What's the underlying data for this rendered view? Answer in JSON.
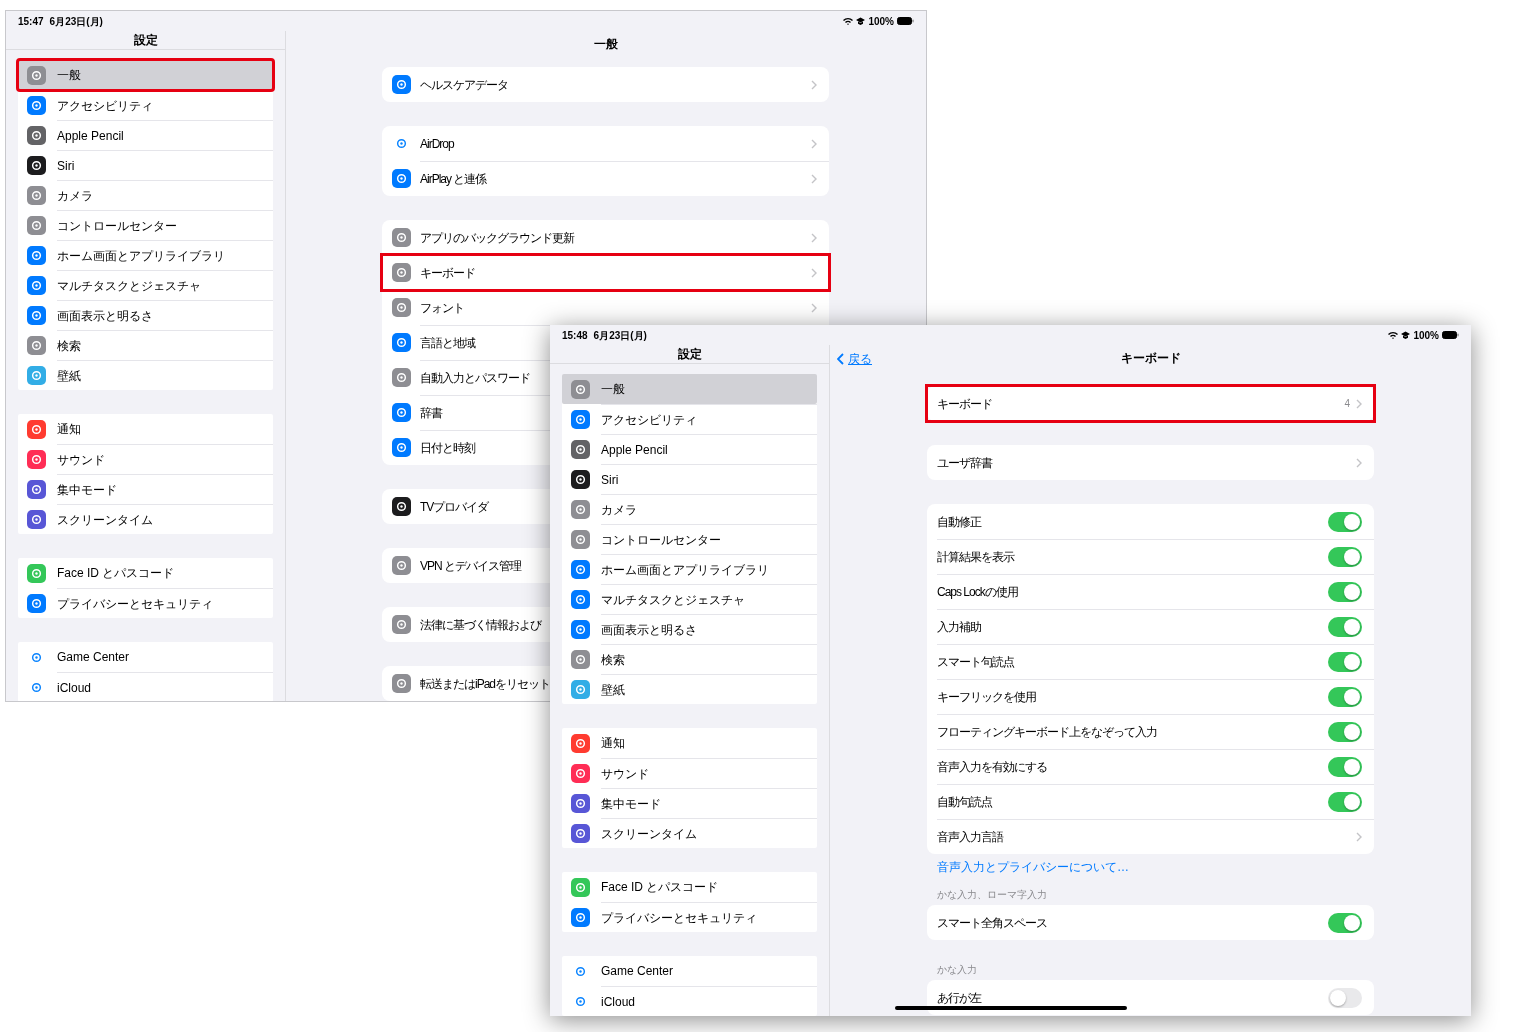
{
  "back_screen": {
    "status_bar": {
      "time": "15:47",
      "date": "6月23日(月)",
      "battery": "100%"
    },
    "sidebar": {
      "title": "設定",
      "groups": [
        {
          "items": [
            {
              "label": "一般",
              "color": "#8e8e93",
              "selected": true,
              "highlighted": true
            },
            {
              "label": "アクセシビリティ",
              "color": "#007aff",
              "selected": false,
              "highlighted": false
            },
            {
              "label": "Apple Pencil",
              "color": "#636366",
              "selected": false,
              "highlighted": false
            },
            {
              "label": "Siri",
              "color": "#1c1c1e",
              "selected": false,
              "highlighted": false
            },
            {
              "label": "カメラ",
              "color": "#8e8e93",
              "selected": false,
              "highlighted": false
            },
            {
              "label": "コントロールセンター",
              "color": "#8e8e93",
              "selected": false,
              "highlighted": false
            },
            {
              "label": "ホーム画面とアプリライブラリ",
              "color": "#007aff",
              "selected": false,
              "highlighted": false
            },
            {
              "label": "マルチタスクとジェスチャ",
              "color": "#007aff",
              "selected": false,
              "highlighted": false
            },
            {
              "label": "画面表示と明るさ",
              "color": "#007aff",
              "selected": false,
              "highlighted": false
            },
            {
              "label": "検索",
              "color": "#8e8e93",
              "selected": false,
              "highlighted": false
            },
            {
              "label": "壁紙",
              "color": "#32ade6",
              "selected": false,
              "highlighted": false
            }
          ]
        },
        {
          "items": [
            {
              "label": "通知",
              "color": "#ff3b30",
              "selected": false,
              "highlighted": false
            },
            {
              "label": "サウンド",
              "color": "#ff2d55",
              "selected": false,
              "highlighted": false
            },
            {
              "label": "集中モード",
              "color": "#5856d6",
              "selected": false,
              "highlighted": false
            },
            {
              "label": "スクリーンタイム",
              "color": "#5856d6",
              "selected": false,
              "highlighted": false
            }
          ]
        },
        {
          "items": [
            {
              "label": "Face ID とパスコード",
              "color": "#34c759",
              "selected": false,
              "highlighted": false
            },
            {
              "label": "プライバシーとセキュリティ",
              "color": "#007aff",
              "selected": false,
              "highlighted": false
            }
          ]
        },
        {
          "items": [
            {
              "label": "Game Center",
              "color": "#ffffff",
              "selected": false,
              "highlighted": false
            },
            {
              "label": "iCloud",
              "color": "#ffffff",
              "selected": false,
              "highlighted": false
            }
          ]
        }
      ]
    },
    "detail": {
      "title": "一般",
      "sections": [
        {
          "rows": [
            {
              "label": "ヘルスケアデータ",
              "color": "#007aff",
              "kind": "link",
              "highlighted": false
            }
          ]
        },
        {
          "rows": [
            {
              "label": "AirDrop",
              "color": "#ffffff",
              "kind": "link",
              "highlighted": false
            },
            {
              "label": "AirPlay と連係",
              "color": "#007aff",
              "kind": "link",
              "highlighted": false
            }
          ]
        },
        {
          "rows": [
            {
              "label": "アプリのバックグラウンド更新",
              "color": "#8e8e93",
              "kind": "link",
              "highlighted": false
            },
            {
              "label": "キーボード",
              "color": "#8e8e93",
              "kind": "link",
              "highlighted": true
            },
            {
              "label": "フォント",
              "color": "#8e8e93",
              "kind": "link",
              "highlighted": false
            },
            {
              "label": "言語と地域",
              "color": "#007aff",
              "kind": "link",
              "highlighted": false
            },
            {
              "label": "自動入力とパスワード",
              "color": "#8e8e93",
              "kind": "link",
              "highlighted": false
            },
            {
              "label": "辞書",
              "color": "#007aff",
              "kind": "link",
              "highlighted": false
            },
            {
              "label": "日付と時刻",
              "color": "#007aff",
              "kind": "link",
              "highlighted": false
            }
          ]
        },
        {
          "rows": [
            {
              "label": "TVプロバイダ",
              "color": "#1c1c1e",
              "kind": "link",
              "highlighted": false
            }
          ]
        },
        {
          "rows": [
            {
              "label": "VPN とデバイス管理",
              "color": "#8e8e93",
              "kind": "link",
              "highlighted": false
            }
          ]
        },
        {
          "rows": [
            {
              "label": "法律に基づく情報および",
              "color": "#8e8e93",
              "kind": "link",
              "highlighted": false
            }
          ]
        },
        {
          "rows": [
            {
              "label": "転送またはiPadをリセット",
              "color": "#8e8e93",
              "kind": "link",
              "highlighted": false
            }
          ]
        }
      ]
    }
  },
  "front_screen": {
    "status_bar": {
      "time": "15:48",
      "date": "6月23日(月)",
      "battery": "100%"
    },
    "sidebar": {
      "title": "設定",
      "groups": [
        {
          "items": [
            {
              "label": "一般",
              "color": "#8e8e93",
              "selected": true,
              "highlighted": false
            },
            {
              "label": "アクセシビリティ",
              "color": "#007aff",
              "selected": false,
              "highlighted": false
            },
            {
              "label": "Apple Pencil",
              "color": "#636366",
              "selected": false,
              "highlighted": false
            },
            {
              "label": "Siri",
              "color": "#1c1c1e",
              "selected": false,
              "highlighted": false
            },
            {
              "label": "カメラ",
              "color": "#8e8e93",
              "selected": false,
              "highlighted": false
            },
            {
              "label": "コントロールセンター",
              "color": "#8e8e93",
              "selected": false,
              "highlighted": false
            },
            {
              "label": "ホーム画面とアプリライブラリ",
              "color": "#007aff",
              "selected": false,
              "highlighted": false
            },
            {
              "label": "マルチタスクとジェスチャ",
              "color": "#007aff",
              "selected": false,
              "highlighted": false
            },
            {
              "label": "画面表示と明るさ",
              "color": "#007aff",
              "selected": false,
              "highlighted": false
            },
            {
              "label": "検索",
              "color": "#8e8e93",
              "selected": false,
              "highlighted": false
            },
            {
              "label": "壁紙",
              "color": "#32ade6",
              "selected": false,
              "highlighted": false
            }
          ]
        },
        {
          "items": [
            {
              "label": "通知",
              "color": "#ff3b30",
              "selected": false,
              "highlighted": false
            },
            {
              "label": "サウンド",
              "color": "#ff2d55",
              "selected": false,
              "highlighted": false
            },
            {
              "label": "集中モード",
              "color": "#5856d6",
              "selected": false,
              "highlighted": false
            },
            {
              "label": "スクリーンタイム",
              "color": "#5856d6",
              "selected": false,
              "highlighted": false
            }
          ]
        },
        {
          "items": [
            {
              "label": "Face ID とパスコード",
              "color": "#34c759",
              "selected": false,
              "highlighted": false
            },
            {
              "label": "プライバシーとセキュリティ",
              "color": "#007aff",
              "selected": false,
              "highlighted": false
            }
          ]
        },
        {
          "items": [
            {
              "label": "Game Center",
              "color": "#ffffff",
              "selected": false,
              "highlighted": false
            },
            {
              "label": "iCloud",
              "color": "#ffffff",
              "selected": false,
              "highlighted": false
            }
          ]
        }
      ]
    },
    "detail": {
      "back_link": "戻る",
      "title": "キーボード",
      "sections": [
        {
          "rows": [
            {
              "label": "キーボード",
              "kind": "link",
              "value": "4",
              "highlighted": true
            }
          ]
        },
        {
          "rows": [
            {
              "label": "ユーザ辞書",
              "kind": "link",
              "highlighted": false
            }
          ]
        },
        {
          "rows": [
            {
              "label": "自動修正",
              "kind": "toggle",
              "on": true,
              "highlighted": false
            },
            {
              "label": "計算結果を表示",
              "kind": "toggle",
              "on": true,
              "highlighted": false
            },
            {
              "label": "Caps Lockの使用",
              "kind": "toggle",
              "on": true,
              "highlighted": false
            },
            {
              "label": "入力補助",
              "kind": "toggle",
              "on": true,
              "highlighted": false
            },
            {
              "label": "スマート句読点",
              "kind": "toggle",
              "on": true,
              "highlighted": false
            },
            {
              "label": "キーフリックを使用",
              "kind": "toggle",
              "on": true,
              "highlighted": false
            },
            {
              "label": "フローティングキーボード上をなぞって入力",
              "kind": "toggle",
              "on": true,
              "highlighted": false
            },
            {
              "label": "音声入力を有効にする",
              "kind": "toggle",
              "on": true,
              "highlighted": false
            },
            {
              "label": "自動句読点",
              "kind": "toggle",
              "on": true,
              "highlighted": false
            },
            {
              "label": "音声入力言語",
              "kind": "link",
              "highlighted": false
            }
          ],
          "footer": "音声入力とプライバシーについて…"
        },
        {
          "header": "かな入力、ローマ字入力",
          "rows": [
            {
              "label": "スマート全角スペース",
              "kind": "toggle",
              "on": true,
              "highlighted": false
            }
          ]
        },
        {
          "header": "かな入力",
          "rows": [
            {
              "label": "あ行が左",
              "kind": "toggle",
              "on": false,
              "highlighted": false
            }
          ]
        }
      ]
    }
  }
}
